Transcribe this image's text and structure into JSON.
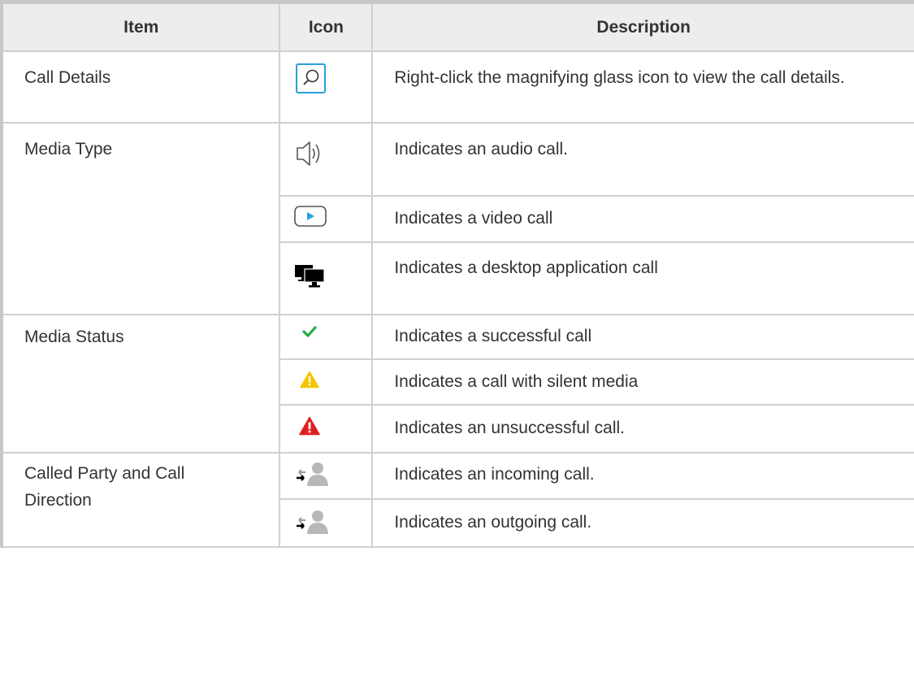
{
  "headers": {
    "item": "Item",
    "icon": "Icon",
    "description": "Description"
  },
  "groups": [
    {
      "item": "Call Details"
    },
    {
      "item": "Media Type"
    },
    {
      "item": "Media Status"
    },
    {
      "item": "Called Party and Call Direction"
    }
  ],
  "rows": [
    {
      "icon": "magnifying-glass-icon",
      "description": "Right-click the magnifying glass icon to view the call details."
    },
    {
      "icon": "speaker-icon",
      "description": "Indicates an audio call."
    },
    {
      "icon": "video-play-icon",
      "description": "Indicates a video call"
    },
    {
      "icon": "dual-monitor-icon",
      "description": "Indicates a desktop application call"
    },
    {
      "icon": "green-check-icon",
      "description": "Indicates a successful call"
    },
    {
      "icon": "yellow-warning-icon",
      "description": "Indicates a call with silent media"
    },
    {
      "icon": "red-warning-icon",
      "description": "Indicates an unsuccessful call."
    },
    {
      "icon": "incoming-call-person-icon",
      "description": "Indicates an incoming call."
    },
    {
      "icon": "outgoing-call-person-icon",
      "description": "Indicates an outgoing call."
    }
  ],
  "colors": {
    "header_bg": "#ededed",
    "border": "#d0d0d0",
    "accent_blue": "#2a9fd8",
    "success_green": "#2aa84a",
    "warning_yellow": "#f5c400",
    "error_red": "#e02020"
  }
}
